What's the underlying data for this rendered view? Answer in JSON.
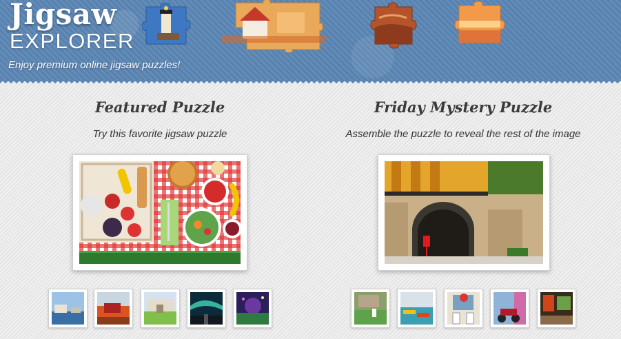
{
  "header": {
    "logo_word": "Jigsaw",
    "logo_sub": "EXPLORER",
    "tagline": "Enjoy premium online jigsaw puzzles!"
  },
  "featured": {
    "title": "Featured Puzzle",
    "subtitle": "Try this favorite jigsaw puzzle"
  },
  "mystery": {
    "title": "Friday Mystery Puzzle",
    "subtitle": "Assemble the puzzle to reveal the rest of the image"
  },
  "colors": {
    "header_blue": "#5b86b5",
    "page_bg": "#e9e9e9",
    "title_text": "#3b3b3b"
  }
}
